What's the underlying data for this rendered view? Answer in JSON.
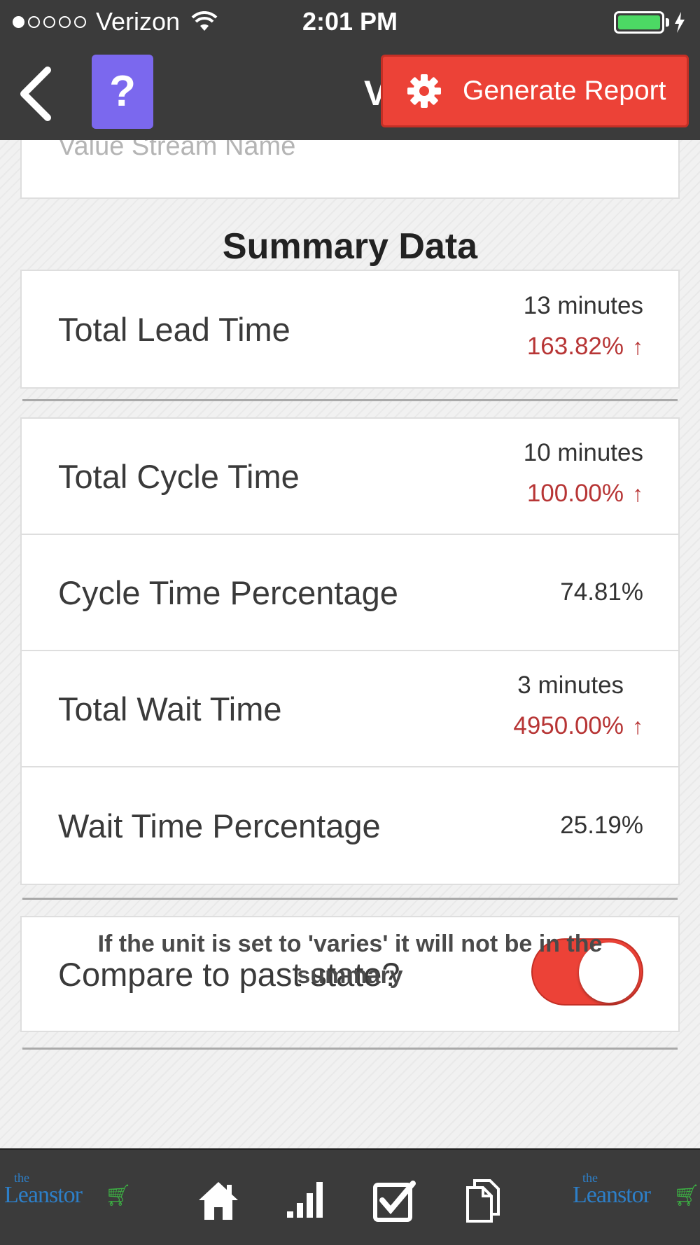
{
  "status_bar": {
    "carrier": "Verizon",
    "time": "2:01 PM",
    "signal_filled": 1,
    "signal_total": 5,
    "battery_level": 1.0
  },
  "header": {
    "title": "V",
    "help_label": "?",
    "report_button_label": "Generate Report",
    "report_icon": "gear-icon",
    "back_icon": "chevron-left-icon"
  },
  "form": {
    "value_stream_name_placeholder": "Value Stream Name",
    "value_stream_name_value": ""
  },
  "summary": {
    "title": "Summary Data",
    "lead": {
      "label": "Total Lead Time",
      "value": "13 minutes",
      "change": "163.82%",
      "change_icon": "arrow-up-icon"
    },
    "rows": [
      {
        "label": "Total Cycle Time",
        "value": "10 minutes",
        "change": "100.00%",
        "change_icon": "arrow-up-icon"
      },
      {
        "label": "Cycle Time Percentage",
        "value": "74.81%"
      },
      {
        "label": "Total Wait Time",
        "value": "3 minutes",
        "change": "4950.00%",
        "change_icon": "arrow-up-icon"
      },
      {
        "label": "Wait Time Percentage",
        "value": "25.19%"
      }
    ]
  },
  "compare": {
    "label": "Compare to past state?",
    "enabled": true
  },
  "note": "If the unit is set to 'varies' it will not be in the summary",
  "bottom_nav": {
    "logo_small": "the",
    "logo_text": "Leanstor",
    "items": [
      "home-icon",
      "stats-icon",
      "checklist-icon",
      "documents-icon"
    ]
  },
  "colors": {
    "accent": "#ec4237",
    "help_button": "#7b68ee",
    "bar_background": "#3b3b3b",
    "change_text": "#b73535",
    "battery": "#4cd964"
  }
}
